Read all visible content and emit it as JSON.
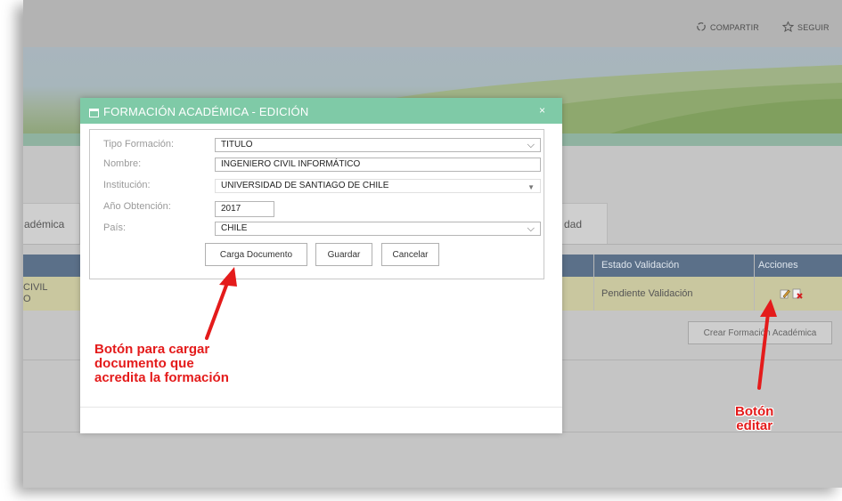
{
  "topbar": {
    "share_label": "COMPARTIR",
    "follow_label": "SEGUIR"
  },
  "tabs": {
    "left_partial": "adémica",
    "right_partial": "dad"
  },
  "table": {
    "headers": {
      "estado": "Estado Validación",
      "acciones": "Acciones"
    },
    "row": {
      "name_line1": "CIVIL",
      "name_line2": "O",
      "estado": "Pendiente Validación"
    }
  },
  "create_button": "Crear Formación Académica",
  "modal": {
    "title": "FORMACIÓN ACADÉMICA - EDICIÓN",
    "close": "×",
    "fields": {
      "tipo_label": "Tipo Formación:",
      "tipo_value": "TITULO",
      "nombre_label": "Nombre:",
      "nombre_value": "INGENIERO CIVIL INFORMÁTICO",
      "institucion_label": "Institución:",
      "institucion_value": "UNIVERSIDAD DE SANTIAGO DE CHILE",
      "anio_label": "Año Obtención:",
      "anio_value": "2017",
      "pais_label": "País:",
      "pais_value": "CHILE"
    },
    "buttons": {
      "carga": "Carga Documento",
      "guardar": "Guardar",
      "cancelar": "Cancelar"
    }
  },
  "annotations": {
    "upload_note_1": "Botón para cargar",
    "upload_note_2": "documento que",
    "upload_note_3": "acredita la formación",
    "edit_note_1": "Botón",
    "edit_note_2": "editar"
  },
  "colors": {
    "modal_header": "#7fcaa7",
    "table_header": "#5b7089",
    "row_highlight": "#c9c79f",
    "annotation": "#e41b1b"
  }
}
